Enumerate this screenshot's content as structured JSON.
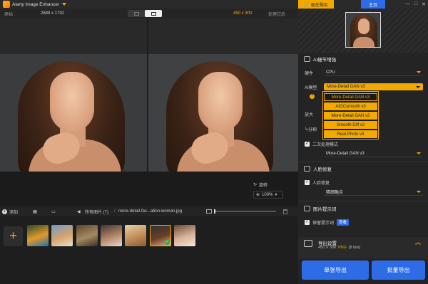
{
  "app": {
    "title": "Aiarty Image Enhancer"
  },
  "compare": {
    "original_label": "原始",
    "original_size": "2688 x 1792",
    "output_size": "450 x 300",
    "processed_label": "处理过后"
  },
  "preview": {
    "rotate_label": "旋转",
    "zoom": "100%"
  },
  "toolbar": {
    "add_label": "添加",
    "all_images_label": "所有图片 (7)",
    "separator": "/",
    "filename": "more-detail-fac...ation-woman.jpg"
  },
  "thumbnails": [
    {
      "name": "colorful-bird",
      "colors": [
        "#2a4a2a",
        "#e39a2a",
        "#1d6fb0"
      ]
    },
    {
      "name": "sky-landscape",
      "colors": [
        "#6d9ad0",
        "#d6a46a",
        "#e7e0cf"
      ]
    },
    {
      "name": "wildlife-cub",
      "colors": [
        "#5a4630",
        "#a68a62",
        "#3a2e22"
      ]
    },
    {
      "name": "couple-portrait",
      "colors": [
        "#40352e",
        "#b4876a",
        "#e8d9c8"
      ]
    },
    {
      "name": "sunlit-portrait",
      "colors": [
        "#e6d2a6",
        "#c28d57",
        "#8a5a36"
      ]
    },
    {
      "name": "curly-woman",
      "colors": [
        "#2f3133",
        "#6a3f26",
        "#e0aa88"
      ],
      "selected": true
    },
    {
      "name": "bride-portrait",
      "colors": [
        "#6a4a36",
        "#d9b39a",
        "#f4e6da"
      ]
    }
  ],
  "right_panel": {
    "buy_label": "现在购买",
    "home_label": "主页",
    "ai_detail": {
      "title": "AI细节增强",
      "hardware_label": "硬件",
      "hardware_value": "CPU",
      "model_label": "AI模型",
      "model_value": "More-Detail GAN  v3",
      "models": [
        "More-Detail GAN  v3",
        "AIGCsmooth  v3",
        "More-Detail GAN  v2",
        "Smooth Diff  v2",
        "Real-Photo  v3"
      ],
      "upscale_label": "放大",
      "partial_label": "分割",
      "second_pass_label": "二次处理模式",
      "second_pass_model": "More-Detail GAN  v3"
    },
    "face": {
      "title": "人脸修复",
      "face_fix_label": "人脸修复",
      "face_fix_mode": "精细融合"
    },
    "prompt": {
      "title": "图片提示词",
      "keep_label": "保留提示词",
      "view_label": "查看"
    },
    "export": {
      "title": "导出设置",
      "size": "450 X 300",
      "format": "PNG",
      "bits": "[8 bits]",
      "single_label": "单张导出",
      "batch_label": "批量导出"
    }
  },
  "colors": {
    "accent": "#f2a900",
    "primary": "#2e6be6",
    "background": "#1b1b1b"
  }
}
